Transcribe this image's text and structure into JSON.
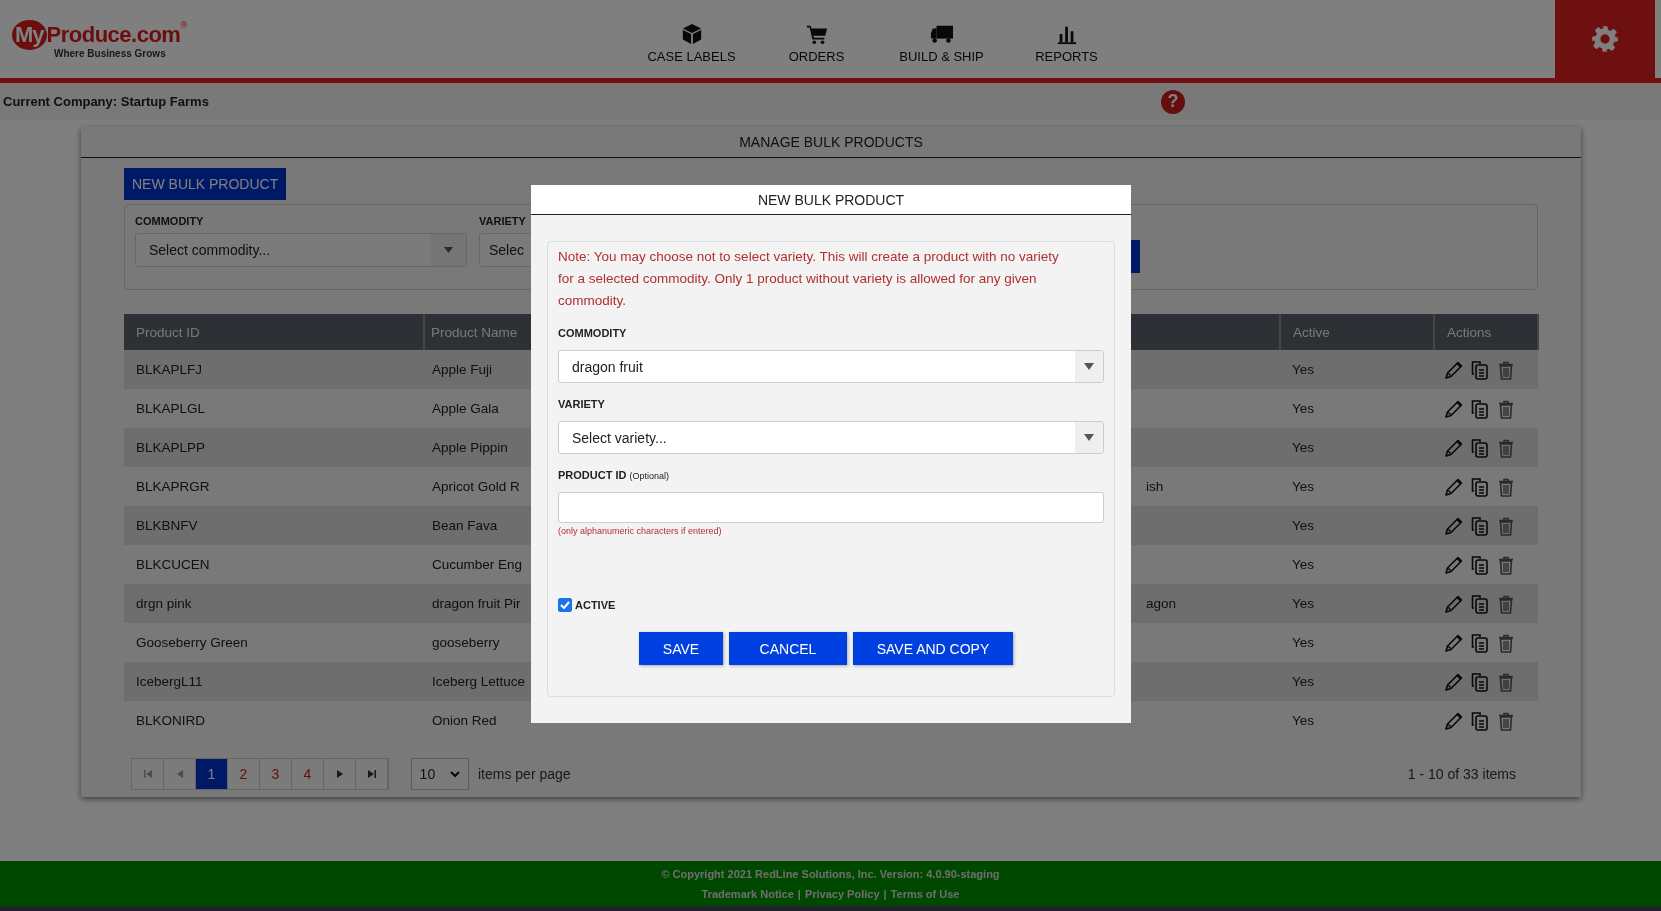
{
  "header": {
    "logo": {
      "brand_prefix": "My",
      "brand": "Produce.com",
      "registered": "®",
      "tagline": "Where Business Grows"
    },
    "nav": [
      {
        "label": "CASE LABELS"
      },
      {
        "label": "ORDERS"
      },
      {
        "label": "BUILD & SHIP"
      },
      {
        "label": "REPORTS"
      }
    ]
  },
  "company_bar": {
    "text": "Current Company: Startup Farms",
    "help": "?"
  },
  "panel": {
    "title": "MANAGE BULK PRODUCTS",
    "new_button": "NEW BULK PRODUCT",
    "filters": [
      {
        "label": "COMMODITY",
        "placeholder": "Select commodity..."
      },
      {
        "label": "VARIETY",
        "placeholder": "Selec"
      }
    ],
    "table": {
      "columns": [
        "Product ID",
        "Product Name",
        "Active",
        "Actions"
      ],
      "rows": [
        {
          "product_id": "BLKAPLFJ",
          "product_name": "Apple Fuji",
          "active": "Yes"
        },
        {
          "product_id": "BLKAPLGL",
          "product_name": "Apple Gala",
          "active": "Yes"
        },
        {
          "product_id": "BLKAPLPP",
          "product_name": "Apple Pippin",
          "active": "Yes"
        },
        {
          "product_id": "BLKAPRGR",
          "product_name": "Apricot Gold R",
          "column_4": "ish",
          "active": "Yes"
        },
        {
          "product_id": "BLKBNFV",
          "product_name": "Bean Fava",
          "active": "Yes"
        },
        {
          "product_id": "BLKCUCEN",
          "product_name": "Cucumber Eng",
          "active": "Yes"
        },
        {
          "product_id": "drgn pink",
          "product_name": "dragon fruit Pir",
          "column_4": "agon",
          "active": "Yes"
        },
        {
          "product_id": "Gooseberry Green",
          "product_name": "gooseberry",
          "active": "Yes"
        },
        {
          "product_id": "IcebergL11",
          "product_name": "Iceberg Lettuce",
          "active": "Yes"
        },
        {
          "product_id": "BLKONIRD",
          "product_name": "Onion Red",
          "active": "Yes"
        }
      ]
    },
    "pagination": {
      "pages": [
        {
          "label": "1",
          "selected": true
        },
        {
          "label": "2",
          "selected": false
        },
        {
          "label": "3",
          "selected": false
        },
        {
          "label": "4",
          "selected": false
        }
      ],
      "page_size": "10",
      "page_size_label": "items per page",
      "summary": "1 - 10 of 33 items"
    }
  },
  "footer": {
    "copyright": "© Copyright 2021 RedLine Solutions, Inc. Version: 4.0.90-staging",
    "links": [
      "Trademark Notice",
      "Privacy Policy",
      "Terms of Use"
    ],
    "separator": "|"
  },
  "modal": {
    "title": "NEW BULK PRODUCT",
    "note": "Note: You may choose not to select variety. This will create a product with no variety for a selected commodity. Only 1 product without variety is allowed for any given commodity.",
    "fields": [
      {
        "kind": "select",
        "label": "COMMODITY",
        "value": "dragon fruit"
      },
      {
        "kind": "select",
        "label": "VARIETY",
        "placeholder": "Select variety..."
      },
      {
        "kind": "text",
        "label": "PRODUCT ID",
        "label_note": "(Optional)",
        "hint": "(only alphanumeric characters if entered)"
      }
    ],
    "active": {
      "label": "ACTIVE",
      "checked": true
    },
    "buttons": [
      "SAVE",
      "CANCEL",
      "SAVE AND COPY"
    ]
  }
}
